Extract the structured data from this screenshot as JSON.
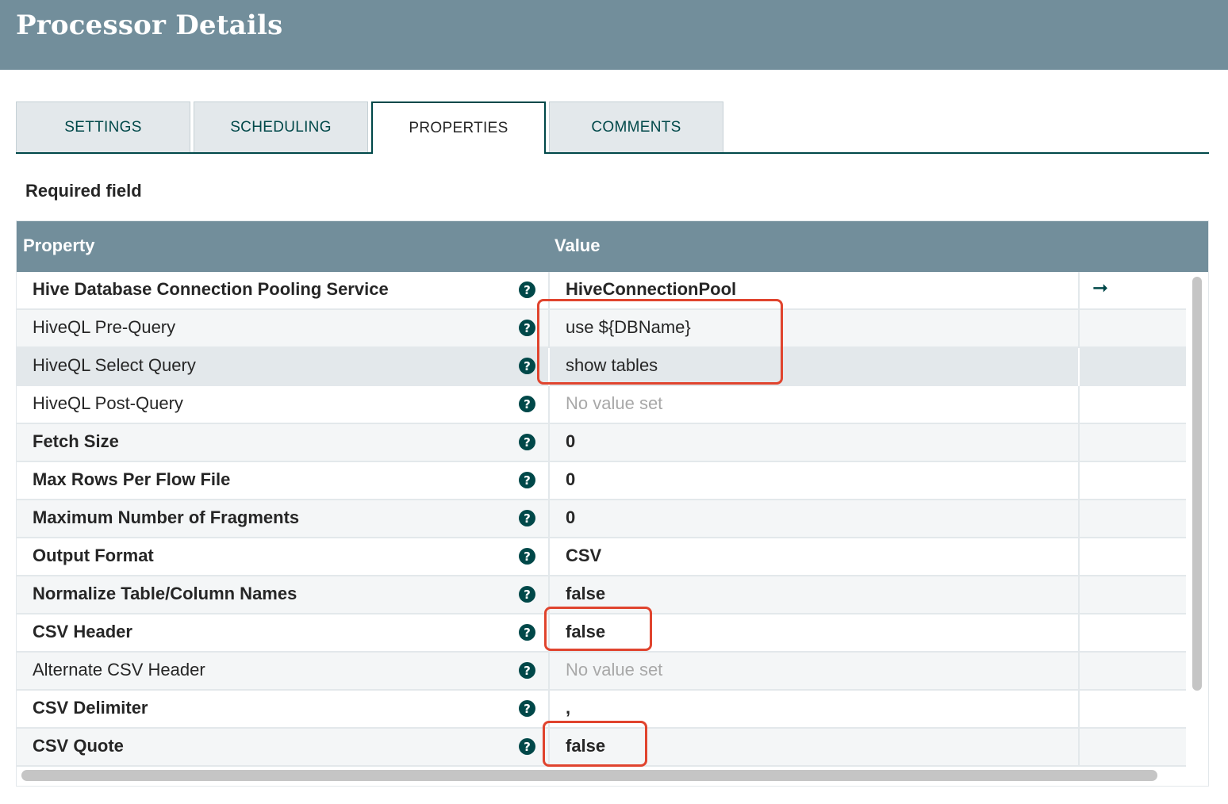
{
  "header": {
    "title": "Processor Details"
  },
  "tabs": [
    {
      "label": "SETTINGS"
    },
    {
      "label": "SCHEDULING"
    },
    {
      "label": "PROPERTIES"
    },
    {
      "label": "COMMENTS"
    }
  ],
  "required_label": "Required field",
  "table": {
    "columns": {
      "property": "Property",
      "value": "Value"
    },
    "help_glyph": "?",
    "arrow_glyph": "➞",
    "rows": [
      {
        "name": "Hive Database Connection Pooling Service",
        "value": "HiveConnectionPool"
      },
      {
        "name": "HiveQL Pre-Query",
        "value": "use ${DBName}"
      },
      {
        "name": "HiveQL Select Query",
        "value": "show tables"
      },
      {
        "name": "HiveQL Post-Query",
        "value": "No value set"
      },
      {
        "name": "Fetch Size",
        "value": "0"
      },
      {
        "name": "Max Rows Per Flow File",
        "value": "0"
      },
      {
        "name": "Maximum Number of Fragments",
        "value": "0"
      },
      {
        "name": "Output Format",
        "value": "CSV"
      },
      {
        "name": "Normalize Table/Column Names",
        "value": "false"
      },
      {
        "name": "CSV Header",
        "value": "false"
      },
      {
        "name": "Alternate CSV Header",
        "value": "No value set"
      },
      {
        "name": "CSV Delimiter",
        "value": ","
      },
      {
        "name": "CSV Quote",
        "value": "false"
      }
    ]
  },
  "colors": {
    "header": "#728e9b",
    "accent": "#004849",
    "highlight": "#e0442e"
  },
  "icons": {
    "help": "question-circle-icon",
    "go_to": "arrow-right-icon"
  }
}
